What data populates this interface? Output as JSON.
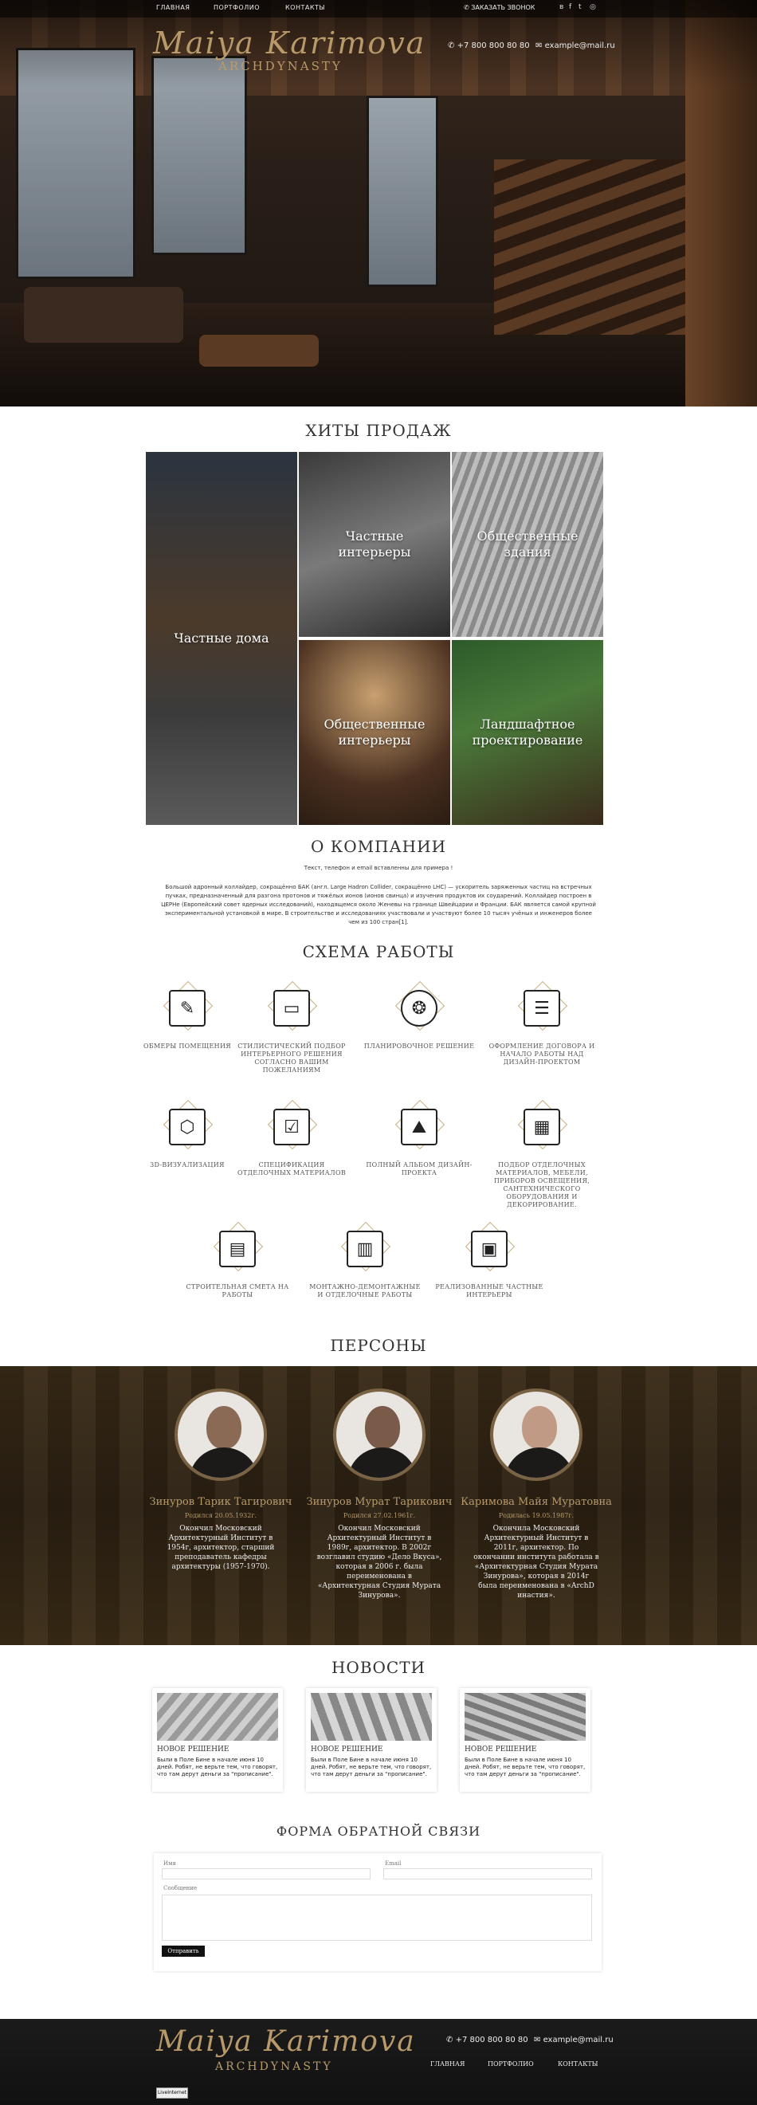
{
  "nav": {
    "home": "ГЛАВНАЯ",
    "portfolio": "ПОРТФОЛИО",
    "contacts": "КОНТАКТЫ"
  },
  "topbar": {
    "callback": "ЗАКАЗАТЬ ЗВОНОК",
    "social": [
      "vk-icon",
      "facebook-icon",
      "twitter-icon",
      "instagram-icon"
    ]
  },
  "brand": {
    "name": "Maiya Karimova",
    "tagline": "ARCHDYNASTY"
  },
  "contacts": {
    "phone": "+7 800 800 80 80",
    "email": "example@mail.ru"
  },
  "hits": {
    "title": "ХИТЫ ПРОДАЖ",
    "tiles": [
      "Частные дома",
      "Частные интерьеры",
      "Общественные здания",
      "Общественные интерьеры",
      "Ландшафтное проектирование"
    ]
  },
  "about": {
    "title": "О КОМПАНИИ",
    "note": "Текст, телефон и email вставленны для примера !",
    "text": "Большой адронный коллайдер, сокращённо БАК (англ. Large Hadron Collider, сокращённо LHC) — ускоритель заряженных частиц на встречных пучках, предназначенный для разгона протонов и тяжёлых ионов (ионов свинца) и изучения продуктов их соударений. Коллайдер построен в ЦЕРНе (Европейский совет ядерных исследований), находящемся около Женевы на границе Швейцарии и Франции. БАК является самой крупной экспериментальной установкой в мире. В строительстве и исследованиях участвовали и участвуют более 10 тысяч учёных и инженеров более чем из 100 стран[1]."
  },
  "scheme": {
    "title": "СХЕМА РАБОТЫ",
    "steps": [
      {
        "label": "ОБМЕРЫ ПОМЕЩЕНИЯ",
        "icon": "ruler-pencil-icon"
      },
      {
        "label": "СТИЛИСТИЧЕСКИЙ ПОДБОР ИНТЕРЬЕРНОГО РЕШЕНИЯ СОГЛАСНО ВАШИМ ПОЖЕЛАНИЯМ",
        "icon": "monitor-design-icon"
      },
      {
        "label": "ПЛАНИРОВОЧНОЕ РЕШЕНИЕ",
        "icon": "brain-icon"
      },
      {
        "label": "ОФОРМЛЕНИЕ ДОГОВОРА И НАЧАЛО РАБОТЫ НАД ДИЗАЙН-ПРОЕКТОМ",
        "icon": "contract-icon"
      },
      {
        "label": "3D-ВИЗУАЛИЗАЦИЯ",
        "icon": "cube-monitor-icon"
      },
      {
        "label": "СПЕЦИФИКАЦИЯ ОТДЕЛОЧНЫХ МАТЕРИАЛОВ",
        "icon": "checklist-icon"
      },
      {
        "label": "ПОЛНЫЙ АЛЬБОМ ДИЗАЙН-ПРОЕКТА",
        "icon": "picture-icon"
      },
      {
        "label": "ПОДБОР ОТДЕЛОЧНЫХ МАТЕРИАЛОВ, МЕБЕЛИ, ПРИБОРОВ ОСВЕЩЕНИЯ, САНТЕХНИЧЕСКОГО ОБОРУДОВАНИЯ И ДЕКОРИРОВАНИЕ.",
        "icon": "blueprint-icon"
      },
      {
        "label": "СТРОИТЕЛЬНАЯ СМЕТА НА РАБОТЫ",
        "icon": "calculator-icon"
      },
      {
        "label": "МОНТАЖНО-ДЕМОНТАЖНЫЕ И ОТДЕЛОЧНЫЕ РАБОТЫ",
        "icon": "color-swatches-icon"
      },
      {
        "label": "РЕАЛИЗОВАННЫЕ ЧАСТНЫЕ ИНТЕРЬЕРЫ",
        "icon": "floor-plan-icon"
      }
    ]
  },
  "persons": {
    "title": "ПЕРСОНЫ",
    "people": [
      {
        "name": "Зинуров Тарик Тагирович",
        "born": "Родился 20.05.1932г.",
        "bio": "Окончил Московский Архитектурный Институт в 1954г, архитектор, старший преподаватель кафедры архитектуры (1957-1970)."
      },
      {
        "name": "Зинуров Мурат Тарикович",
        "born": "Родился 27.02.1961г.",
        "bio": "Окончил Московский Архитектурный Институт в 1989г, архитектор. В 2002г возглавил студию «Дело Вкуса», которая в 2006 г. была переименована в «Архитектурная Студия Мурата Зинурова»."
      },
      {
        "name": "Каримова Майя Муратовна",
        "born": "Родилась 19.05.1987г.",
        "bio": "Окончила Московский Архитектурный Институт в 2011г, архитектор. По окончании института работала в «Архитектурная Студия Мурата Зинурова», которая в 2014г была переименована в «ArchD инастия»."
      }
    ]
  },
  "news": {
    "title": "НОВОСТИ",
    "items": [
      {
        "title": "НОВОЕ РЕШЕНИЕ",
        "text": "Были в Поле Бине в начале июня 10 дней. Робят, не верьте тем, что говорят, что там дерут деньги за \"прописание\"."
      },
      {
        "title": "НОВОЕ РЕШЕНИЕ",
        "text": "Были в Поле Бине в начале июня 10 дней. Робят, не верьте тем, что говорят, что там дерут деньги за \"прописание\"."
      },
      {
        "title": "НОВОЕ РЕШЕНИЕ",
        "text": "Были в Поле Бине в начале июня 10 дней. Робят, не верьте тем, что говорят, что там дерут деньги за \"прописание\"."
      }
    ]
  },
  "form": {
    "title": "ФОРМА ОБРАТНОЙ СВЯЗИ",
    "name_label": "Имя",
    "email_label": "Email",
    "message_label": "Сообщение",
    "submit": "Отправить"
  },
  "footer": {
    "counter": "LiveInternet"
  }
}
